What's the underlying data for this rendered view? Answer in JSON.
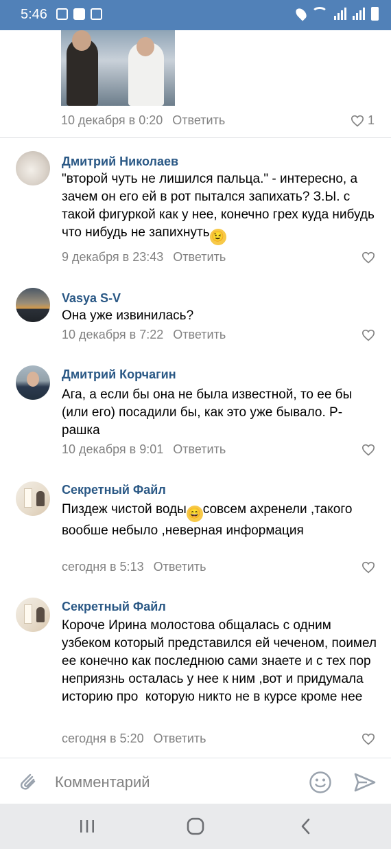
{
  "status_bar": {
    "time": "5:46"
  },
  "post": {
    "date": "10 декабря в 0:20",
    "reply_label": "Ответить",
    "likes": "1"
  },
  "comments": [
    {
      "author": "Дмитрий Николаев",
      "text": "\"второй чуть не лишился пальца.\" - интересно, а зачем он его ей в рот пытался запихать? З.Ы. с такой фигуркой как у нее, конечно грех куда нибудь что нибудь не запихнуть",
      "emoji": "wink-emoji",
      "date": "9 декабря в 23:43",
      "reply_label": "Ответить"
    },
    {
      "author": "Vasya S-V",
      "text": "Она уже извинилась?",
      "date": "10 декабря в 7:22",
      "reply_label": "Ответить"
    },
    {
      "author": "Дмитрий Корчагин",
      "text": "Ага, а если бы она не была известной, то ее бы (или его) посадили бы, как это уже бывало. Р-рашка",
      "date": "10 декабря в 9:01",
      "reply_label": "Ответить"
    },
    {
      "author": "Секретный Файл",
      "text_before_emoji": "Пиздеж чистой воды",
      "emoji": "grin-emoji",
      "text_after_emoji": "совсем ахренели ,такого вообше небыло ,неверная информация",
      "date": "сегодня в 5:13",
      "reply_label": "Ответить"
    },
    {
      "author": "Секретный Файл",
      "text": "Короче Ирина молостова общалась с одним узбеком который представился ей чеченом, поимел ее конечно как последнюю сами знаете и с тех пор неприязнь осталась у нее к ним ,вот и придумала историю про  которую никто не в курсе кроме нее",
      "date": "сегодня в 5:20",
      "reply_label": "Ответить"
    }
  ],
  "composer": {
    "placeholder": "Комментарий"
  },
  "colors": {
    "status_bar": "#5181b8",
    "author": "#2a5885",
    "meta": "#828282"
  }
}
